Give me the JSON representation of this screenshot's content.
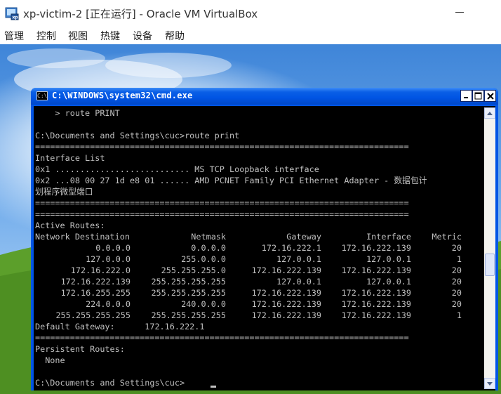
{
  "vbox": {
    "title": "xp-victim-2 [正在运行] - Oracle VM VirtualBox",
    "menu": [
      "管理",
      "控制",
      "视图",
      "热键",
      "设备",
      "帮助"
    ]
  },
  "cmd": {
    "title": "C:\\WINDOWS\\system32\\cmd.exe",
    "lines": [
      "    > route PRINT",
      "",
      "C:\\Documents and Settings\\cuc>route print",
      "===========================================================================",
      "Interface List",
      "0x1 ........................... MS TCP Loopback interface",
      "0x2 ...08 00 27 1d e8 01 ...... AMD PCNET Family PCI Ethernet Adapter - 数据包计",
      "划程序微型端口",
      "===========================================================================",
      "===========================================================================",
      "Active Routes:"
    ],
    "route_header": [
      "Network Destination",
      "Netmask",
      "Gateway",
      "Interface",
      "Metric"
    ],
    "routes": [
      [
        "0.0.0.0",
        "0.0.0.0",
        "172.16.222.1",
        "172.16.222.139",
        "20"
      ],
      [
        "127.0.0.0",
        "255.0.0.0",
        "127.0.0.1",
        "127.0.0.1",
        "1"
      ],
      [
        "172.16.222.0",
        "255.255.255.0",
        "172.16.222.139",
        "172.16.222.139",
        "20"
      ],
      [
        "172.16.222.139",
        "255.255.255.255",
        "127.0.0.1",
        "127.0.0.1",
        "20"
      ],
      [
        "172.16.255.255",
        "255.255.255.255",
        "172.16.222.139",
        "172.16.222.139",
        "20"
      ],
      [
        "224.0.0.0",
        "240.0.0.0",
        "172.16.222.139",
        "172.16.222.139",
        "20"
      ],
      [
        "255.255.255.255",
        "255.255.255.255",
        "172.16.222.139",
        "172.16.222.139",
        "1"
      ]
    ],
    "tail_lines": [
      "Default Gateway:      172.16.222.1",
      "===========================================================================",
      "Persistent Routes:",
      "  None",
      "",
      "C:\\Documents and Settings\\cuc>"
    ]
  }
}
